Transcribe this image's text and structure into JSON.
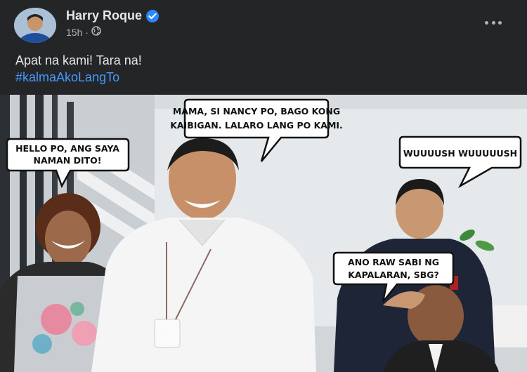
{
  "post": {
    "author": "Harry Roque",
    "time": "15h",
    "separator": "·",
    "caption": "Apat na kami! Tara na!",
    "hashtag": "#kalmaAkoLangTo"
  },
  "icons": {
    "verified": "verified-badge-icon",
    "audience": "globe-icon",
    "more": "more-options-icon"
  },
  "colors": {
    "background": "#242526",
    "text": "#e4e6eb",
    "meta": "#b0b3b8",
    "link": "#4599ff",
    "verified": "#2d88ff"
  },
  "photo": {
    "bubbles": [
      {
        "lines": [
          "HELLO PO, ANG SAYA",
          "NAMAN DITO!"
        ]
      },
      {
        "lines": [
          "MAMA, SI NANCY PO, BAGO KONG",
          "KAIBIGAN. LALARO LANG PO KAMI."
        ]
      },
      {
        "lines": [
          "WUUUUSH WUUUUUSH"
        ]
      },
      {
        "lines": [
          "ANO RAW SABI NG",
          "KAPALARAN, SBG?"
        ]
      }
    ]
  }
}
